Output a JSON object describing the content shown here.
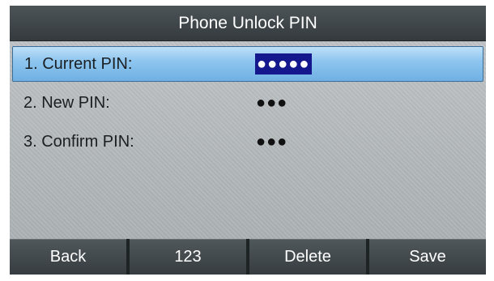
{
  "title": "Phone Unlock PIN",
  "fields": [
    {
      "label": "1. Current PIN:",
      "value": "●●●●●",
      "selected": true
    },
    {
      "label": "2. New PIN:",
      "value": "●●●",
      "selected": false
    },
    {
      "label": "3. Confirm PIN:",
      "value": "●●●",
      "selected": false
    }
  ],
  "softkeys": {
    "back": "Back",
    "input_mode": "123",
    "delete": "Delete",
    "save": "Save"
  },
  "colors": {
    "title_bar": "#3f4549",
    "selected_row": "#8fc6ef",
    "active_value_bg": "#14188c",
    "softkey_bg": "#3f4549"
  }
}
